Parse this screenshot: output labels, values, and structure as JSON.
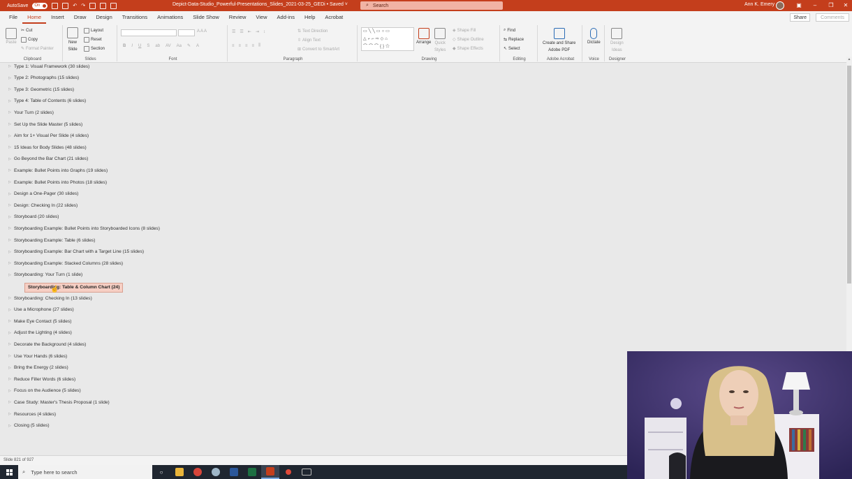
{
  "titlebar": {
    "autosave_label": "AutoSave",
    "autosave_state": "On",
    "doc_title": "Depict-Data-Studio_Powerful-Presentations_Slides_2021-03-25_GEDi  •  Saved  ˅",
    "search_placeholder": "Search",
    "user_name": "Ann K. Emery",
    "accent_color": "#c43e1c"
  },
  "menu": {
    "tabs": [
      "File",
      "Home",
      "Insert",
      "Draw",
      "Design",
      "Transitions",
      "Animations",
      "Slide Show",
      "Review",
      "View",
      "Add-ins",
      "Help",
      "Acrobat"
    ],
    "active_tab": "Home",
    "share_label": "Share",
    "comments_label": "Comments"
  },
  "ribbon": {
    "clipboard": {
      "label": "Clipboard",
      "paste": "Paste",
      "cut": "Cut",
      "copy": "Copy",
      "format_painter": "Format Painter"
    },
    "slides": {
      "label": "Slides",
      "new_slide": "New",
      "new_slide2": "Slide",
      "layout": "Layout",
      "reset": "Reset",
      "section": "Section"
    },
    "font": {
      "label": "Font"
    },
    "paragraph": {
      "label": "Paragraph",
      "text_direction": "Text Direction",
      "align_text": "Align Text",
      "convert_smartart": "Convert to SmartArt"
    },
    "drawing": {
      "label": "Drawing",
      "arrange": "Arrange",
      "quick_styles": "Quick",
      "quick_styles2": "Styles",
      "shape_fill": "Shape Fill",
      "shape_outline": "Shape Outline",
      "shape_effects": "Shape Effects"
    },
    "editing": {
      "label": "Editing",
      "find": "Find",
      "replace": "Replace",
      "select": "Select"
    },
    "adobe": {
      "label": "Adobe Acrobat",
      "create_share": "Create and Share",
      "create_share2": "Adobe PDF"
    },
    "voice": {
      "label": "Voice",
      "dictate": "Dictate"
    },
    "designer": {
      "label": "Designer",
      "design_ideas": "Design",
      "design_ideas2": "Ideas"
    }
  },
  "sections": [
    "Type 1: Visual Framework (30 slides)",
    "Type 2: Photographs (15 slides)",
    "Type 3: Geometric (15 slides)",
    "Type 4: Table of Contents (6 slides)",
    "Your Turn (2 slides)",
    "Set Up the Slide Master (5 slides)",
    "Aim for 1+ Visual Per Slide (4 slides)",
    "15 Ideas for Body Slides (48 slides)",
    "Go Beyond the Bar Chart (21 slides)",
    "Example: Bullet Points into Graphs (19 slides)",
    "Example: Bullet Points into Photos (18 slides)",
    "Design a One-Pager (30 slides)",
    "Design: Checking In (22 slides)",
    "Storyboard (20 slides)",
    "Storyboarding Example: Bullet Points into Storyboarded Icons (8 slides)",
    "Storyboarding Example: Table (6 slides)",
    "Storyboarding Example: Bar Chart with a Target Line (15 slides)",
    "Storyboarding Example: Stacked Columns (28 slides)",
    "Storyboarding: Your Turn (1 slide)",
    "Storyboarding: Checking In (13 slides)",
    "Use a Microphone (27 slides)",
    "Make Eye Contact (5 slides)",
    "Adjust the Lighting (4 slides)",
    "Decorate the Background (4 slides)",
    "Use Your Hands (6 slides)",
    "Bring the Energy (2 slides)",
    "Reduce Filler Words (6 slides)",
    "Focus on the Audience (5 slides)",
    "Case Study: Master's Thesis Proposal (1 slide)",
    "Resources (4 slides)",
    "Closing (5 slides)"
  ],
  "drag_item": "Storyboarding: Table & Column Chart (24)",
  "status": {
    "slide_counter": "Slide 821 of 927"
  },
  "taskbar": {
    "search_placeholder": "Type here to search"
  }
}
